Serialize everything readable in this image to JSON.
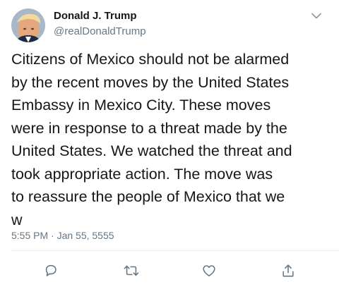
{
  "author": {
    "display_name": "Donald J. Trump",
    "handle": "@realDonaldTrump"
  },
  "tweet": {
    "lines": [
      "Citizens of Mexico should not be alarmed",
      "by the recent moves by the United States",
      "Embassy in Mexico City. These moves",
      "were in response to a threat made by the",
      "United States. We watched the threat and",
      "took appropriate action. The move was",
      "to reassure the people of Mexico that we",
      "w"
    ],
    "timestamp": "5:55 PM · Jan 55, 5555"
  },
  "icons": {
    "menu": "chevron-down-icon",
    "reply": "reply-icon",
    "retweet": "retweet-icon",
    "like": "heart-icon",
    "share": "share-icon"
  },
  "colors": {
    "text": "#14171a",
    "secondary": "#657786",
    "divider": "#e6ecf0"
  }
}
